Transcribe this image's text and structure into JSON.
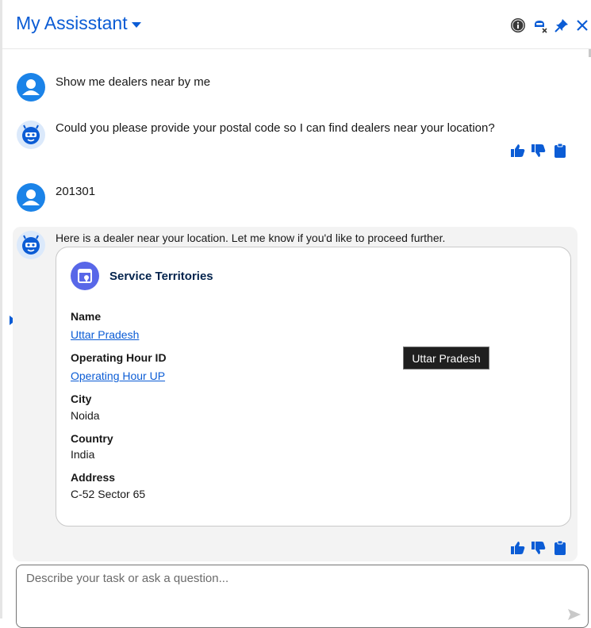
{
  "header": {
    "title": "My Assisstant",
    "icons": [
      "info-icon",
      "privacy-mask-icon",
      "pin-icon",
      "close-icon"
    ]
  },
  "messages": [
    {
      "role": "user",
      "text": "Show me dealers near by me"
    },
    {
      "role": "bot",
      "text": "Could you please provide your postal code so I can find dealers near your location?"
    },
    {
      "role": "user",
      "text": "201301"
    },
    {
      "role": "bot",
      "text": "Here is a dealer near your location. Let me know if you'd like to proceed further."
    }
  ],
  "card": {
    "title": "Service Territories",
    "icon": "map-pin-document-icon",
    "fields": [
      {
        "label": "Name",
        "value": "Uttar Pradesh",
        "link": true
      },
      {
        "label": "Operating Hour ID",
        "value": "Operating Hour UP",
        "link": true
      },
      {
        "label": "City",
        "value": "Noida",
        "link": false
      },
      {
        "label": "Country",
        "value": "India",
        "link": false
      },
      {
        "label": "Address",
        "value": "C-52 Sector 65",
        "link": false
      }
    ]
  },
  "tooltip": {
    "text": "Uttar Pradesh"
  },
  "composer": {
    "placeholder": "Describe your task or ask a question...",
    "value": ""
  },
  "colors": {
    "accent": "#0b5cd5",
    "user_avatar": "#1b83e8",
    "card_icon": "#5867e8",
    "card_title": "#03234d"
  }
}
